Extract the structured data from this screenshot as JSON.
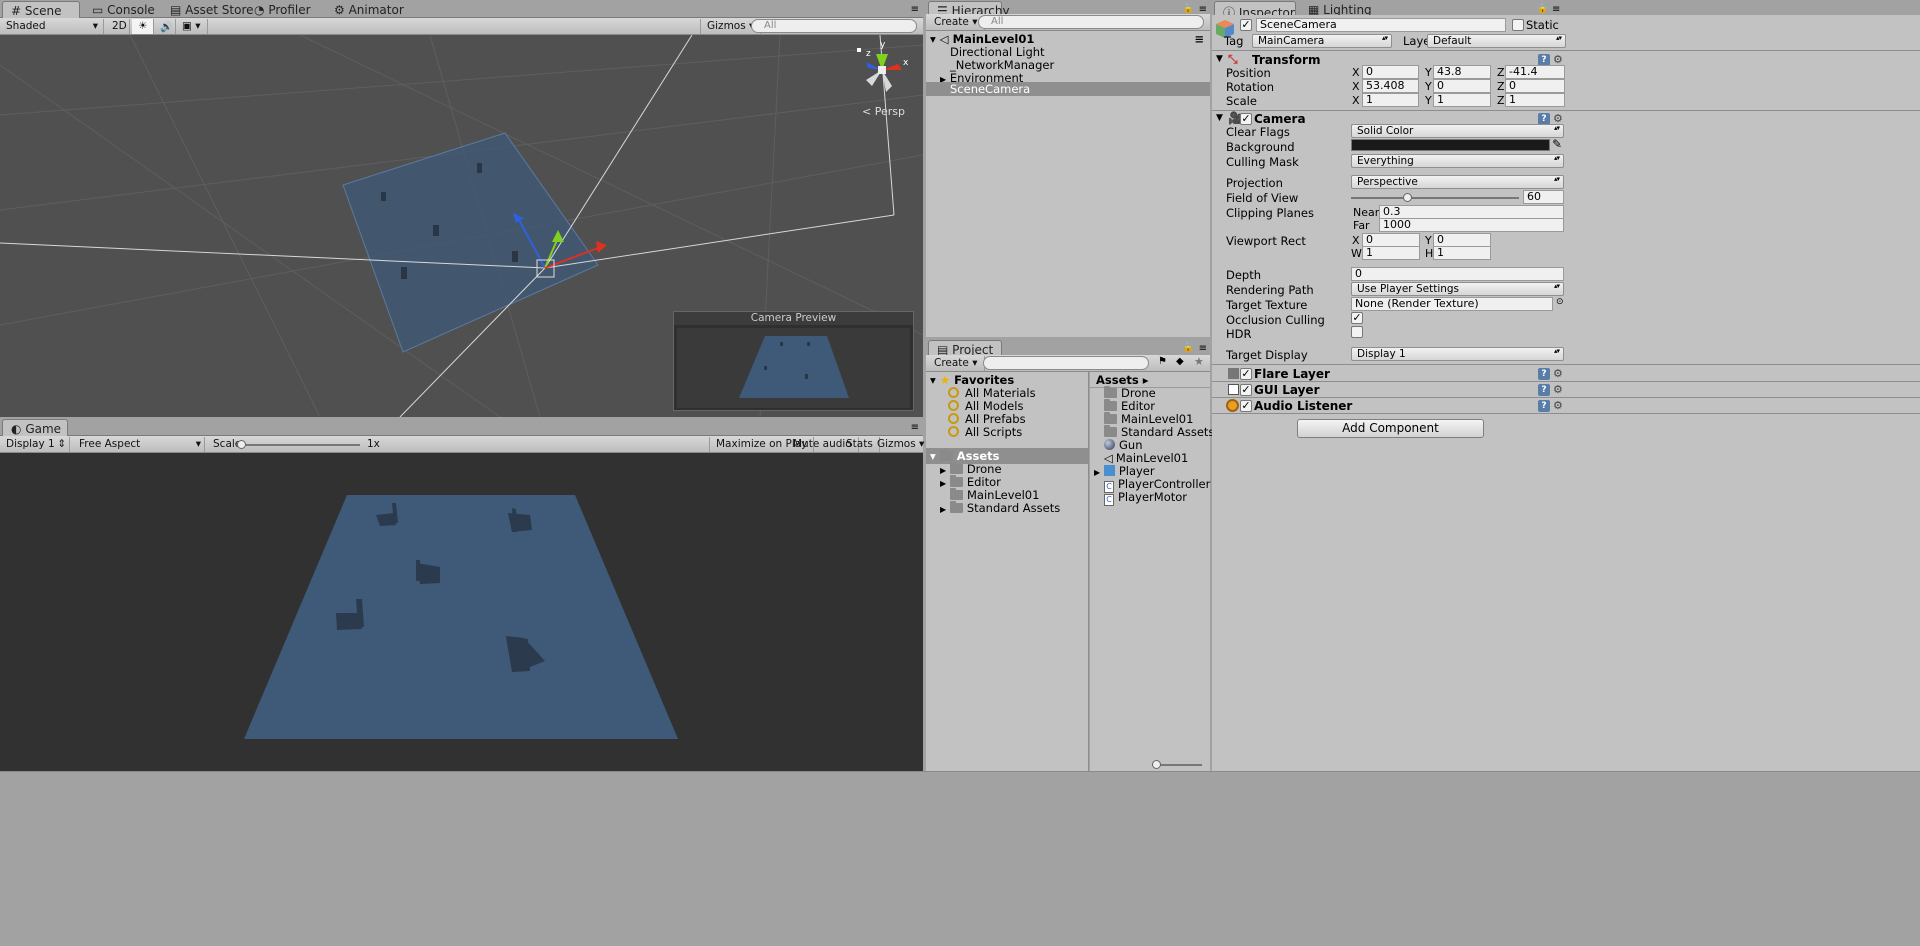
{
  "scene": {
    "tabs": [
      "Scene",
      "Console",
      "Asset Store",
      "Profiler",
      "Animator"
    ],
    "shading": "Shaded",
    "mode_2d": "2D",
    "gizmos": "Gizmos",
    "search_placeholder": "All",
    "persp_label": "Persp",
    "gizmo_axes": {
      "x": "x",
      "y": "y",
      "z": "z"
    },
    "camera_preview_title": "Camera Preview"
  },
  "game": {
    "tab": "Game",
    "display": "Display 1",
    "aspect": "Free Aspect",
    "scale_label": "Scale",
    "scale_value": "1x",
    "buttons": [
      "Maximize on Play",
      "Mute audio",
      "Stats",
      "Gizmos"
    ]
  },
  "hierarchy": {
    "tab": "Hierarchy",
    "create": "Create",
    "search_placeholder": "All",
    "scene_name": "MainLevel01",
    "items": [
      {
        "label": "Directional Light",
        "foldout": false,
        "selected": false
      },
      {
        "label": "_NetworkManager",
        "foldout": false,
        "selected": false
      },
      {
        "label": "Environment",
        "foldout": true,
        "selected": false
      },
      {
        "label": "SceneCamera",
        "foldout": false,
        "selected": true
      }
    ]
  },
  "project": {
    "tab": "Project",
    "create": "Create",
    "favorites_label": "Favorites",
    "favorites": [
      "All Materials",
      "All Models",
      "All Prefabs",
      "All Scripts"
    ],
    "assets_label": "Assets",
    "tree": [
      {
        "label": "Drone",
        "foldout": true
      },
      {
        "label": "Editor",
        "foldout": true
      },
      {
        "label": "MainLevel01",
        "foldout": false
      },
      {
        "label": "Standard Assets",
        "foldout": true
      }
    ],
    "breadcrumb": "Assets",
    "files": [
      {
        "label": "Drone",
        "icon": "folder-icon"
      },
      {
        "label": "Editor",
        "icon": "folder-icon"
      },
      {
        "label": "MainLevel01",
        "icon": "folder-icon"
      },
      {
        "label": "Standard Assets",
        "icon": "folder-icon"
      },
      {
        "label": "Gun",
        "icon": "sphere-icon"
      },
      {
        "label": "MainLevel01",
        "icon": "unity-scene-icon"
      },
      {
        "label": "Player",
        "icon": "prefab-icon"
      },
      {
        "label": "PlayerController",
        "icon": "script-icon"
      },
      {
        "label": "PlayerMotor",
        "icon": "script-icon"
      }
    ]
  },
  "inspector": {
    "tabs": [
      "Inspector",
      "Lighting"
    ],
    "object_name": "SceneCamera",
    "static_label": "Static",
    "tag_label": "Tag",
    "tag_value": "MainCamera",
    "layer_label": "Layer",
    "layer_value": "Default",
    "transform": {
      "title": "Transform",
      "position_label": "Position",
      "position": {
        "x": "0",
        "y": "43.8",
        "z": "-41.4"
      },
      "rotation_label": "Rotation",
      "rotation": {
        "x": "53.408",
        "y": "0",
        "z": "0"
      },
      "scale_label": "Scale",
      "scale": {
        "x": "1",
        "y": "1",
        "z": "1"
      }
    },
    "camera": {
      "title": "Camera",
      "clear_flags_label": "Clear Flags",
      "clear_flags": "Solid Color",
      "background_label": "Background",
      "background_color": "#1a1a1a",
      "culling_mask_label": "Culling Mask",
      "culling_mask": "Everything",
      "projection_label": "Projection",
      "projection": "Perspective",
      "fov_label": "Field of View",
      "fov": "60",
      "fov_fraction": 0.33,
      "clipping_label": "Clipping Planes",
      "near_label": "Near",
      "near": "0.3",
      "far_label": "Far",
      "far": "1000",
      "viewport_label": "Viewport Rect",
      "vp": {
        "x": "0",
        "y": "0",
        "w": "1",
        "h": "1"
      },
      "depth_label": "Depth",
      "depth": "0",
      "rendering_path_label": "Rendering Path",
      "rendering_path": "Use Player Settings",
      "target_texture_label": "Target Texture",
      "target_texture": "None (Render Texture)",
      "occlusion_label": "Occlusion Culling",
      "occlusion": true,
      "hdr_label": "HDR",
      "hdr": false,
      "target_display_label": "Target Display",
      "target_display": "Display 1"
    },
    "components": [
      "Flare Layer",
      "GUI Layer",
      "Audio Listener"
    ],
    "add_component": "Add Component"
  },
  "colors": {
    "plane": "#3e5a78",
    "selection": "#8f8f8f",
    "scene_bg": "#505050",
    "game_bg": "#313131"
  }
}
